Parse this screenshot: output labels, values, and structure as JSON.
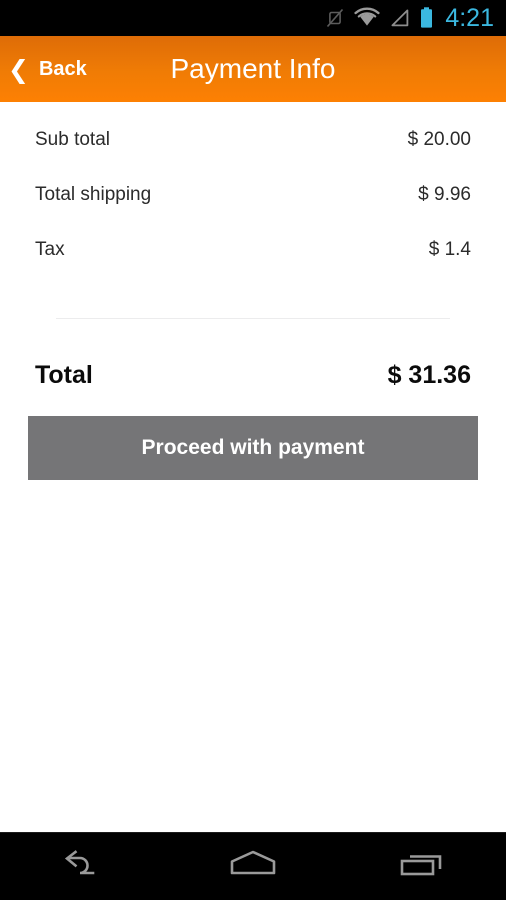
{
  "status_bar": {
    "icons": [
      {
        "name": "vibrate-off-icon",
        "label": "silent"
      },
      {
        "name": "wifi-icon",
        "label": "wifi"
      },
      {
        "name": "cell-signal-icon",
        "label": "signal"
      },
      {
        "name": "battery-icon",
        "label": "battery"
      }
    ],
    "clock": "4:21",
    "accent_color": "#3BB8E0",
    "background_color": "#000000"
  },
  "header": {
    "back_chevron": "❮",
    "back_label": "Back",
    "title": "Payment Info",
    "gradient_top": "#DE6C07",
    "gradient_bottom": "#FD8003",
    "text_color": "#FFFFFF"
  },
  "summary": {
    "rows": [
      {
        "label": "Sub total",
        "value": "$ 20.00"
      },
      {
        "label": "Total shipping",
        "value": "$ 9.96"
      },
      {
        "label": "Tax",
        "value": "$ 1.4"
      }
    ],
    "divider_color": "#ECECED",
    "total": {
      "label": "Total",
      "value": "$ 31.36"
    }
  },
  "actions": {
    "proceed_label": "Proceed with payment",
    "proceed_bg": "#757577",
    "proceed_text_color": "#FFFFFF"
  },
  "nav_bar": {
    "buttons": [
      {
        "name": "nav-back-button",
        "label": "Back"
      },
      {
        "name": "nav-home-button",
        "label": "Home"
      },
      {
        "name": "nav-recents-button",
        "label": "Recent apps"
      }
    ],
    "icon_color": "#9A9A9A",
    "background_color": "#000000"
  }
}
